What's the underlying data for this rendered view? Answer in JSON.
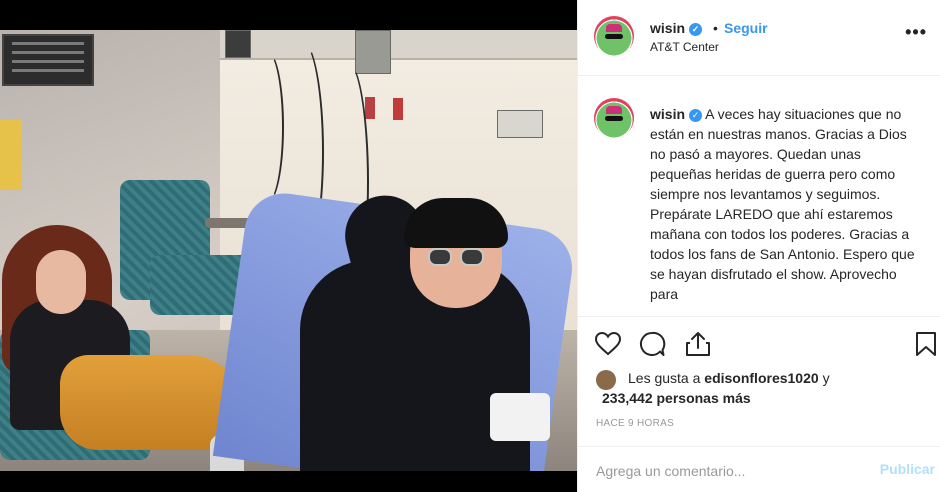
{
  "post": {
    "username": "wisin",
    "separator": "•",
    "follow_label": "Seguir",
    "location": "AT&T Center",
    "more_label": "•••",
    "verified_glyph": "✓"
  },
  "caption": {
    "username": "wisin",
    "text": "A veces hay situaciones que no están en nuestras manos. Gracias a Dios no pasó a mayores. Quedan unas pequeñas heridas de guerra pero como siempre nos levantamos y seguimos. Prepárate LAREDO que ahí estaremos mañana con todos los poderes. Gracias a todos los fans de San Antonio. Espero que se hayan disfrutado el show. Aprovecho para"
  },
  "actions": {
    "icons": [
      "heart-icon",
      "comment-icon",
      "share-icon",
      "bookmark-icon"
    ]
  },
  "likes": {
    "prefix": "Les gusta a",
    "liker": "edisonflores1020",
    "conjunction": "y",
    "others": "233,442 personas más"
  },
  "timestamp": "HACE 9 HORAS",
  "add_comment": {
    "placeholder": "Agrega un comentario...",
    "publish_label": "Publicar"
  },
  "colors": {
    "link_blue": "#3897f0",
    "publish_disabled": "#b2dffc",
    "border": "#efefef"
  }
}
